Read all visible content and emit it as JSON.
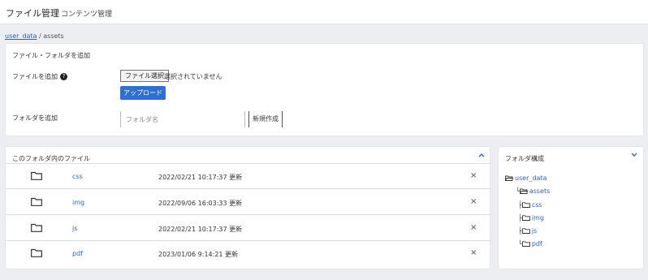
{
  "header": {
    "title": "ファイル管理",
    "subtitle": "コンテンツ管理"
  },
  "breadcrumb": {
    "root": "user_data",
    "sep": " / ",
    "current": "assets"
  },
  "upload_panel": {
    "title": "ファイル・フォルダを追加",
    "file_label": "ファイルを追加",
    "help_icon": "?",
    "choose_file": "ファイル選択",
    "no_file": "選択されていません",
    "upload": "アップロード",
    "folder_label": "フォルダを追加",
    "folder_placeholder": "フォルダ名",
    "create": "新規作成"
  },
  "files_panel": {
    "title": "このフォルダ内のファイル",
    "collapse_icon": "chevron-up-icon",
    "rows": [
      {
        "name": "css",
        "date": "2022/02/21 10:17:37 更新",
        "delete": "×"
      },
      {
        "name": "img",
        "date": "2022/09/06 16:03:33 更新",
        "delete": "×"
      },
      {
        "name": "js",
        "date": "2022/02/21 10:17:37 更新",
        "delete": "×"
      },
      {
        "name": "pdf",
        "date": "2023/01/06 9:14:21 更新",
        "delete": "×"
      }
    ]
  },
  "tree_panel": {
    "title": "フォルダ構成",
    "collapse_icon": "chevron-down-icon",
    "root": "user_data",
    "child": "assets",
    "leaves": [
      "css",
      "img",
      "js",
      "pdf"
    ],
    "connectors": [
      "├",
      "├",
      "├",
      "└"
    ],
    "child_connector": "└"
  },
  "colors": {
    "accent": "#2f6fd0",
    "link": "#2f64b8",
    "background": "#eceef2"
  }
}
